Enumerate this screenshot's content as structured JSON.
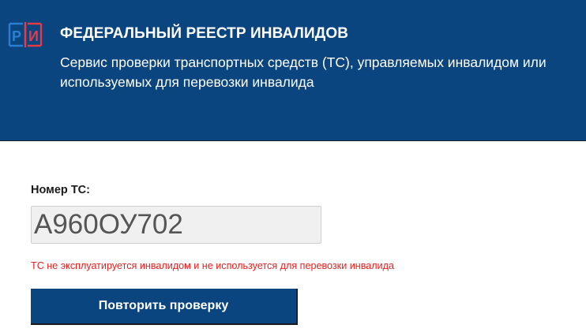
{
  "header": {
    "logo_icon": "fri-logo-icon",
    "logo_letters": [
      "Р",
      "И"
    ],
    "title": "ФЕДЕРАЛЬНЫЙ РЕЕСТР ИНВАЛИДОВ",
    "subtitle": "Сервис проверки транспортных средств (ТС), управляемых инвалидом или используемых для перевозки инвалида"
  },
  "form": {
    "vehicle_label": "Номер ТС:",
    "vehicle_value": "А960ОУ702",
    "error_message": "ТС не эксплуатируется инвалидом и не используется для перевозки инвалида",
    "retry_button_label": "Повторить проверку"
  },
  "colors": {
    "brand_blue": "#0b4580",
    "logo_blue": "#2a7fd4",
    "logo_red": "#e63a46",
    "error_red": "#e8201f",
    "input_bg": "#f0f0f0"
  }
}
